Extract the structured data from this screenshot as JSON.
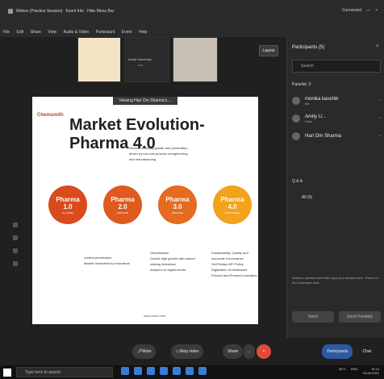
{
  "window": {
    "title": "Webex (Practice Session)",
    "event_info": "Event Info",
    "hide_menu": "Hide Menu Bar",
    "connected": "Connected"
  },
  "menubar": {
    "items": [
      "File",
      "Edit",
      "Share",
      "View",
      "Audio & Video",
      "Participant",
      "Event",
      "Help"
    ]
  },
  "stage": {
    "tile_middle_line1": "Amity University",
    "tile_middle_line2": "Host",
    "layout_button": "Layout"
  },
  "slide": {
    "viewing_label": "Viewing Hari Om Sharma's ...",
    "logo": "Chemsmith",
    "title": "Market Evolution- Pharma 4.0",
    "top_note": "Decade of strong growth and penetration, driven by low cost process reengineering and manufacturing",
    "circles": [
      {
        "line1": "Pharma",
        "line2": "1.0",
        "years": "Pre-1980s",
        "color": "#d94b1d"
      },
      {
        "line1": "Pharma",
        "line2": "2.0",
        "years": "1980-2000",
        "color": "#de5a1e"
      },
      {
        "line1": "Pharma",
        "line2": "3.0",
        "years": "2000-2019",
        "color": "#e46b1f"
      },
      {
        "line1": "Pharma",
        "line2": "4.0",
        "years": "2020 onwards",
        "color": "#f2a21d"
      }
    ],
    "bullets_1": [
      "Limited penetration",
      "Market dominated by innovators"
    ],
    "bullets_3": [
      "Globalization",
      "Double digit growth with market sharing limitations",
      "Adoption of digital media"
    ],
    "bullets_4": [
      "Sustainability, Quality and corporate Governance",
      "Self Reliant API Policy",
      "Digitization of Healthcare",
      "Product and Process Innovation"
    ],
    "footer": "www.cdsci.com"
  },
  "sidebar": {
    "header": "Participants (5)",
    "search_placeholder": "Search",
    "panelist_label": "Panelist: 3",
    "participants": [
      {
        "name": "monika kaushik",
        "sub": "Me"
      },
      {
        "name": "Amity U...",
        "sub": "Host"
      },
      {
        "name": "Hari Om Sharma",
        "sub": ""
      }
    ],
    "qa_label": "Q & A",
    "qa_tab": "All (0)",
    "qa_note": "Select a question and then type your answer here. There's a 512-character limit.",
    "send_label": "Send",
    "send_privately_label": "Send Privately"
  },
  "controls": {
    "mute": "Mute",
    "stop_video": "Stop video",
    "share": "Share",
    "participants": "Participants",
    "chat": "Chat"
  },
  "taskbar": {
    "search_placeholder": "Type here to search",
    "weather": "34°C",
    "lang": "ENG",
    "time": "15:14",
    "date": "25-06-2021"
  }
}
